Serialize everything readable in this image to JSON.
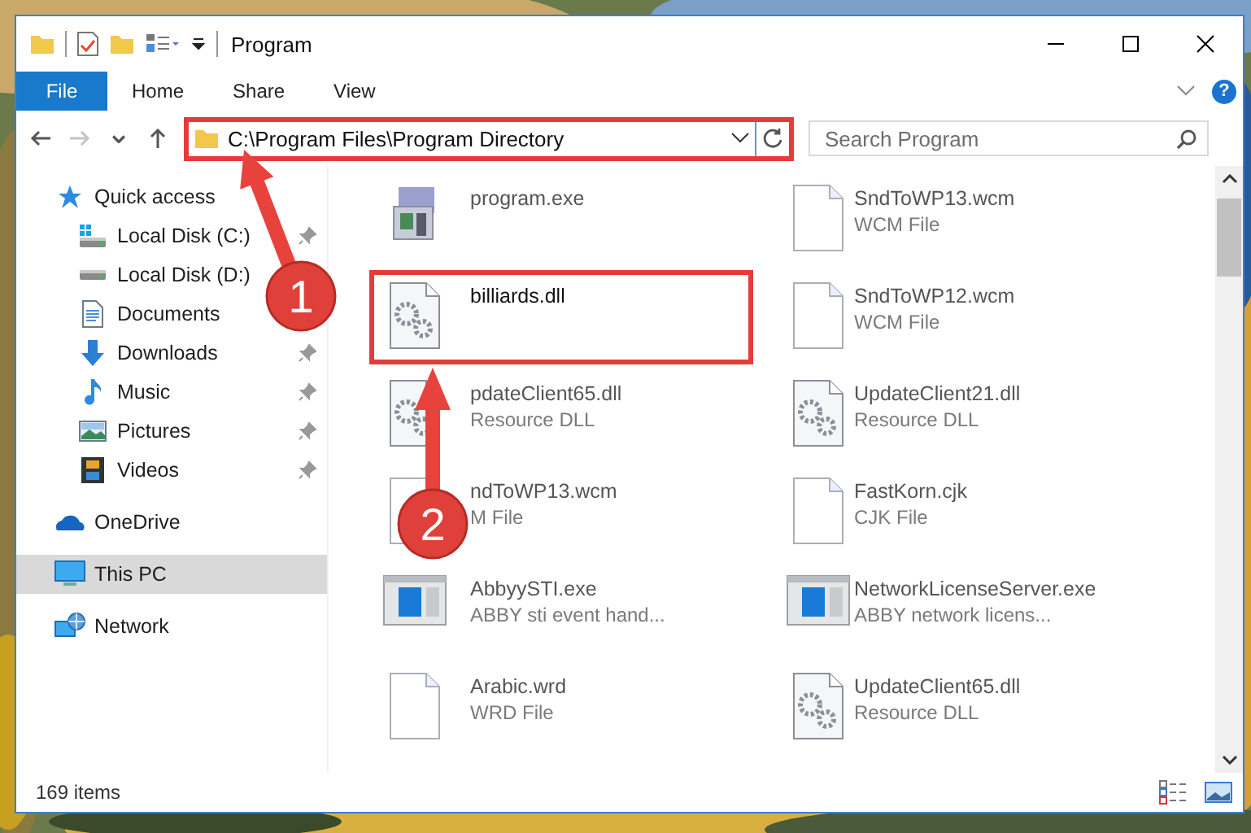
{
  "window": {
    "title": "Program"
  },
  "ribbon": {
    "tabs": [
      {
        "label": "File",
        "selected": true
      },
      {
        "label": "Home",
        "selected": false
      },
      {
        "label": "Share",
        "selected": false
      },
      {
        "label": "View",
        "selected": false
      }
    ],
    "help": "?"
  },
  "navigation": [
    {
      "disabled": false
    },
    {
      "disabled": true
    },
    {
      "disabled": false
    },
    {
      "disabled": false
    }
  ],
  "address": {
    "path": "C:\\Program Files\\Program Directory",
    "highlighted": true
  },
  "search": {
    "placeholder": "Search Program"
  },
  "sidebar": {
    "items": [
      {
        "label": "Quick access",
        "selected": false,
        "children": [
          {
            "label": "Local Disk (C:)",
            "pinned": true,
            "selected": false
          },
          {
            "label": "Local Disk (D:)",
            "pinned": false,
            "selected": false
          },
          {
            "label": "Documents",
            "pinned": false,
            "selected": false
          },
          {
            "label": "Downloads",
            "pinned": true,
            "selected": false
          },
          {
            "label": "Music",
            "pinned": true,
            "selected": false
          },
          {
            "label": "Pictures",
            "pinned": true,
            "selected": false
          },
          {
            "label": "Videos",
            "pinned": true,
            "selected": false
          }
        ]
      },
      {
        "label": "OneDrive",
        "selected": false
      },
      {
        "label": "This PC",
        "selected": true
      },
      {
        "label": "Network",
        "selected": false
      }
    ]
  },
  "files": {
    "items": [
      {
        "name": "program.exe",
        "kind": "program",
        "highlighted": false
      },
      {
        "name": "SndToWP13.wcm",
        "type": "WCM File",
        "kind": "blank",
        "highlighted": false
      },
      {
        "name": "billiards.dll",
        "kind": "dll",
        "highlighted": true
      },
      {
        "name": "SndToWP12.wcm",
        "type": "WCM File",
        "kind": "blank",
        "highlighted": false
      },
      {
        "name": "pdateClient65.dll",
        "type": "Resource DLL",
        "kind": "dll",
        "highlighted": false
      },
      {
        "name": "UpdateClient21.dll",
        "type": "Resource DLL",
        "kind": "dll",
        "highlighted": false
      },
      {
        "name": "ndToWP13.wcm",
        "type": "M File",
        "kind": "blank",
        "highlighted": false
      },
      {
        "name": "FastKorn.cjk",
        "type": "CJK File",
        "kind": "blank",
        "highlighted": false
      },
      {
        "name": "AbbyySTI.exe",
        "type": "ABBY sti event hand...",
        "kind": "app",
        "highlighted": false
      },
      {
        "name": "NetworkLicenseServer.exe",
        "type": "ABBY network licens...",
        "kind": "app",
        "highlighted": false
      },
      {
        "name": "Arabic.wrd",
        "type": "WRD File",
        "kind": "blank",
        "highlighted": false
      },
      {
        "name": "UpdateClient65.dll",
        "type": "Resource DLL",
        "kind": "dll",
        "highlighted": false
      }
    ]
  },
  "status_bar": {
    "count": "169 items"
  },
  "annotations": [
    {
      "label": "1"
    },
    {
      "label": "2"
    }
  ]
}
